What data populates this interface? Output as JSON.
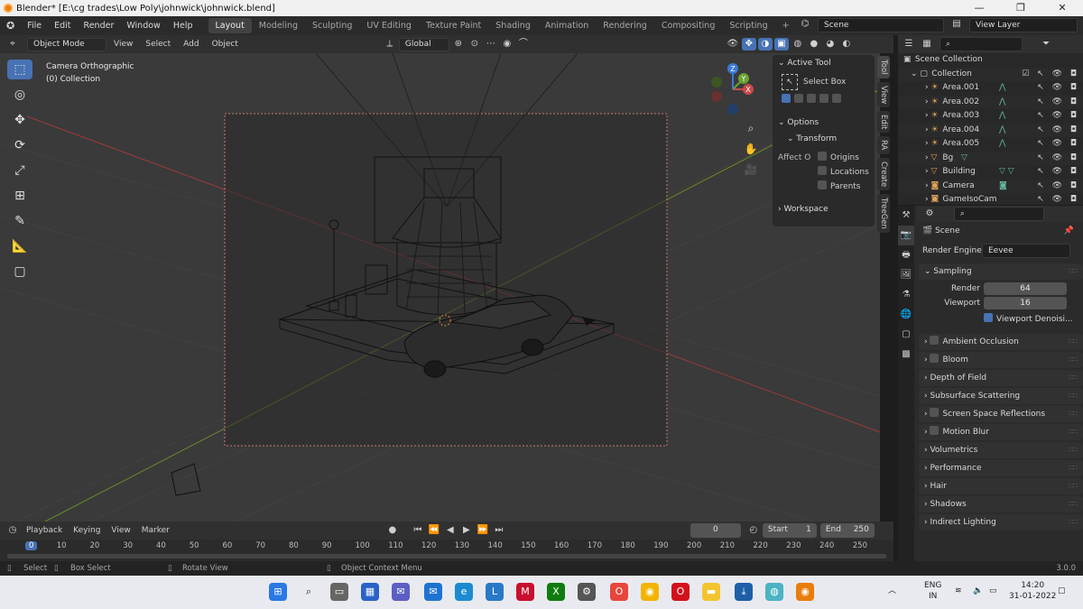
{
  "window": {
    "title": "Blender* [E:\\cg trades\\Low Poly\\johnwick\\johnwick.blend]",
    "controls": [
      "—",
      "❐",
      "✕"
    ]
  },
  "menu": [
    "File",
    "Edit",
    "Render",
    "Window",
    "Help"
  ],
  "workspaces": [
    "Layout",
    "Modeling",
    "Sculpting",
    "UV Editing",
    "Texture Paint",
    "Shading",
    "Animation",
    "Rendering",
    "Compositing",
    "Scripting",
    "+"
  ],
  "top_right": {
    "scene": "Scene",
    "view_layer": "View Layer"
  },
  "viewport_header": {
    "mode": "Object Mode",
    "menus": [
      "View",
      "Select",
      "Add",
      "Object"
    ],
    "orientation": "Global"
  },
  "viewport": {
    "view_name": "Camera Orthographic",
    "collection": "(0) Collection",
    "gizmo": {
      "x": "X",
      "y": "Y",
      "z": "Z"
    }
  },
  "npanel": {
    "active_tool_header": "Active Tool",
    "select_box": "Select Box",
    "options_header": "Options",
    "transform_header": "Transform",
    "affect_label": "Affect O",
    "affect_only": [
      "Origins",
      "Locations",
      "Parents"
    ],
    "workspace_header": "Workspace",
    "tabs": [
      "Tool",
      "View",
      "Edit",
      "RA",
      "Create",
      "TreeGen"
    ]
  },
  "outliner": {
    "root": "Scene Collection",
    "collection": "Collection",
    "items": [
      "Area.001",
      "Area.002",
      "Area.003",
      "Area.004",
      "Area.005",
      "Bg",
      "Building",
      "Camera",
      "GameIsoCam"
    ]
  },
  "properties": {
    "scene_label": "Scene",
    "render_engine_label": "Render Engine",
    "render_engine": "Eevee",
    "sampling_header": "Sampling",
    "render_label": "Render",
    "render_samples": "64",
    "viewport_label": "Viewport",
    "viewport_samples": "16",
    "viewport_denoise": "Viewport Denoisi...",
    "panels": [
      {
        "label": "Ambient Occlusion",
        "checkbox": true
      },
      {
        "label": "Bloom",
        "checkbox": true
      },
      {
        "label": "Depth of Field",
        "checkbox": false
      },
      {
        "label": "Subsurface Scattering",
        "checkbox": false
      },
      {
        "label": "Screen Space Reflections",
        "checkbox": true
      },
      {
        "label": "Motion Blur",
        "checkbox": true
      },
      {
        "label": "Volumetrics",
        "checkbox": false
      },
      {
        "label": "Performance",
        "checkbox": false
      },
      {
        "label": "Hair",
        "checkbox": false
      },
      {
        "label": "Shadows",
        "checkbox": false
      },
      {
        "label": "Indirect Lighting",
        "checkbox": false
      }
    ]
  },
  "timeline": {
    "menus": [
      "Playback",
      "Keying",
      "View",
      "Marker"
    ],
    "current_frame": "0",
    "start_label": "Start",
    "start": "1",
    "end_label": "End",
    "end": "250",
    "ruler": [
      "0",
      "10",
      "20",
      "30",
      "40",
      "50",
      "60",
      "70",
      "80",
      "90",
      "100",
      "110",
      "120",
      "130",
      "140",
      "150",
      "160",
      "170",
      "180",
      "190",
      "200",
      "210",
      "220",
      "230",
      "240",
      "250"
    ]
  },
  "statusbar": {
    "select": "Select",
    "box_select": "Box Select",
    "rotate_view": "Rotate View",
    "context_menu": "Object Context Menu",
    "version": "3.0.0"
  },
  "taskbar": {
    "lang": "ENG",
    "region": "IN",
    "time": "14:20",
    "date": "31-01-2022"
  }
}
